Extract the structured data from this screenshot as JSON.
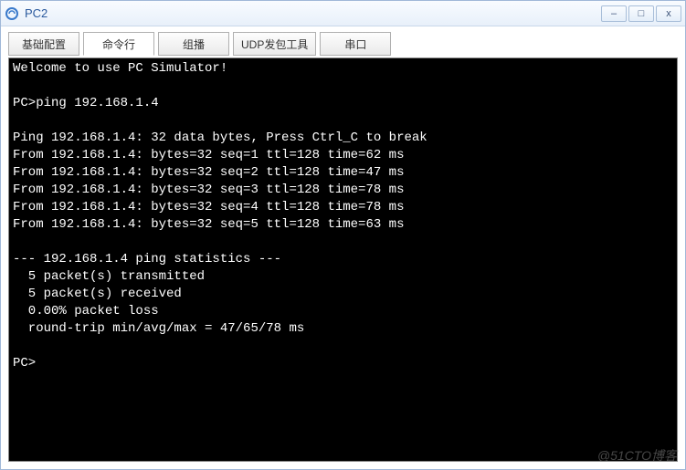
{
  "window": {
    "title": "PC2"
  },
  "tabs": {
    "items": [
      {
        "label": "基础配置"
      },
      {
        "label": "命令行"
      },
      {
        "label": "组播"
      },
      {
        "label": "UDP发包工具"
      },
      {
        "label": "串口"
      }
    ],
    "active_index": 1
  },
  "terminal": {
    "welcome": "Welcome to use PC Simulator!",
    "blank": "",
    "prompt1": "PC>ping 192.168.1.4",
    "header": "Ping 192.168.1.4: 32 data bytes, Press Ctrl_C to break",
    "reply1": "From 192.168.1.4: bytes=32 seq=1 ttl=128 time=62 ms",
    "reply2": "From 192.168.1.4: bytes=32 seq=2 ttl=128 time=47 ms",
    "reply3": "From 192.168.1.4: bytes=32 seq=3 ttl=128 time=78 ms",
    "reply4": "From 192.168.1.4: bytes=32 seq=4 ttl=128 time=78 ms",
    "reply5": "From 192.168.1.4: bytes=32 seq=5 ttl=128 time=63 ms",
    "stats_header": "--- 192.168.1.4 ping statistics ---",
    "stats_tx": "  5 packet(s) transmitted",
    "stats_rx": "  5 packet(s) received",
    "stats_loss": "  0.00% packet loss",
    "stats_rtt": "  round-trip min/avg/max = 47/65/78 ms",
    "prompt2": "PC>"
  },
  "watermark": "@51CTO博客",
  "controls": {
    "minimize": "–",
    "maximize": "□",
    "close": "x"
  }
}
